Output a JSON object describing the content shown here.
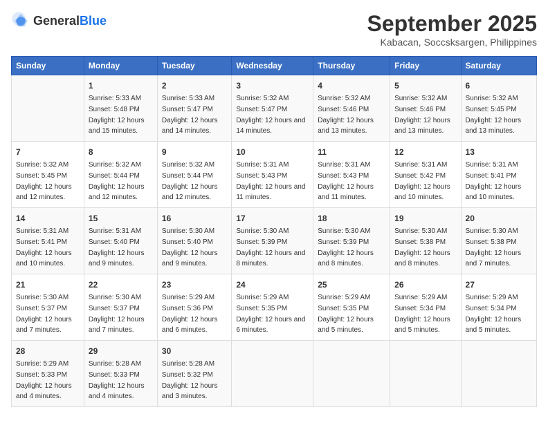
{
  "header": {
    "logo_general": "General",
    "logo_blue": "Blue",
    "title": "September 2025",
    "subtitle": "Kabacan, Soccsksargen, Philippines"
  },
  "days_of_week": [
    "Sunday",
    "Monday",
    "Tuesday",
    "Wednesday",
    "Thursday",
    "Friday",
    "Saturday"
  ],
  "weeks": [
    [
      {
        "day": "",
        "sunrise": "",
        "sunset": "",
        "daylight": ""
      },
      {
        "day": "1",
        "sunrise": "5:33 AM",
        "sunset": "5:48 PM",
        "daylight": "12 hours and 15 minutes."
      },
      {
        "day": "2",
        "sunrise": "5:33 AM",
        "sunset": "5:47 PM",
        "daylight": "12 hours and 14 minutes."
      },
      {
        "day": "3",
        "sunrise": "5:32 AM",
        "sunset": "5:47 PM",
        "daylight": "12 hours and 14 minutes."
      },
      {
        "day": "4",
        "sunrise": "5:32 AM",
        "sunset": "5:46 PM",
        "daylight": "12 hours and 13 minutes."
      },
      {
        "day": "5",
        "sunrise": "5:32 AM",
        "sunset": "5:46 PM",
        "daylight": "12 hours and 13 minutes."
      },
      {
        "day": "6",
        "sunrise": "5:32 AM",
        "sunset": "5:45 PM",
        "daylight": "12 hours and 13 minutes."
      }
    ],
    [
      {
        "day": "7",
        "sunrise": "5:32 AM",
        "sunset": "5:45 PM",
        "daylight": "12 hours and 12 minutes."
      },
      {
        "day": "8",
        "sunrise": "5:32 AM",
        "sunset": "5:44 PM",
        "daylight": "12 hours and 12 minutes."
      },
      {
        "day": "9",
        "sunrise": "5:32 AM",
        "sunset": "5:44 PM",
        "daylight": "12 hours and 12 minutes."
      },
      {
        "day": "10",
        "sunrise": "5:31 AM",
        "sunset": "5:43 PM",
        "daylight": "12 hours and 11 minutes."
      },
      {
        "day": "11",
        "sunrise": "5:31 AM",
        "sunset": "5:43 PM",
        "daylight": "12 hours and 11 minutes."
      },
      {
        "day": "12",
        "sunrise": "5:31 AM",
        "sunset": "5:42 PM",
        "daylight": "12 hours and 10 minutes."
      },
      {
        "day": "13",
        "sunrise": "5:31 AM",
        "sunset": "5:41 PM",
        "daylight": "12 hours and 10 minutes."
      }
    ],
    [
      {
        "day": "14",
        "sunrise": "5:31 AM",
        "sunset": "5:41 PM",
        "daylight": "12 hours and 10 minutes."
      },
      {
        "day": "15",
        "sunrise": "5:31 AM",
        "sunset": "5:40 PM",
        "daylight": "12 hours and 9 minutes."
      },
      {
        "day": "16",
        "sunrise": "5:30 AM",
        "sunset": "5:40 PM",
        "daylight": "12 hours and 9 minutes."
      },
      {
        "day": "17",
        "sunrise": "5:30 AM",
        "sunset": "5:39 PM",
        "daylight": "12 hours and 8 minutes."
      },
      {
        "day": "18",
        "sunrise": "5:30 AM",
        "sunset": "5:39 PM",
        "daylight": "12 hours and 8 minutes."
      },
      {
        "day": "19",
        "sunrise": "5:30 AM",
        "sunset": "5:38 PM",
        "daylight": "12 hours and 8 minutes."
      },
      {
        "day": "20",
        "sunrise": "5:30 AM",
        "sunset": "5:38 PM",
        "daylight": "12 hours and 7 minutes."
      }
    ],
    [
      {
        "day": "21",
        "sunrise": "5:30 AM",
        "sunset": "5:37 PM",
        "daylight": "12 hours and 7 minutes."
      },
      {
        "day": "22",
        "sunrise": "5:30 AM",
        "sunset": "5:37 PM",
        "daylight": "12 hours and 7 minutes."
      },
      {
        "day": "23",
        "sunrise": "5:29 AM",
        "sunset": "5:36 PM",
        "daylight": "12 hours and 6 minutes."
      },
      {
        "day": "24",
        "sunrise": "5:29 AM",
        "sunset": "5:35 PM",
        "daylight": "12 hours and 6 minutes."
      },
      {
        "day": "25",
        "sunrise": "5:29 AM",
        "sunset": "5:35 PM",
        "daylight": "12 hours and 5 minutes."
      },
      {
        "day": "26",
        "sunrise": "5:29 AM",
        "sunset": "5:34 PM",
        "daylight": "12 hours and 5 minutes."
      },
      {
        "day": "27",
        "sunrise": "5:29 AM",
        "sunset": "5:34 PM",
        "daylight": "12 hours and 5 minutes."
      }
    ],
    [
      {
        "day": "28",
        "sunrise": "5:29 AM",
        "sunset": "5:33 PM",
        "daylight": "12 hours and 4 minutes."
      },
      {
        "day": "29",
        "sunrise": "5:28 AM",
        "sunset": "5:33 PM",
        "daylight": "12 hours and 4 minutes."
      },
      {
        "day": "30",
        "sunrise": "5:28 AM",
        "sunset": "5:32 PM",
        "daylight": "12 hours and 3 minutes."
      },
      {
        "day": "",
        "sunrise": "",
        "sunset": "",
        "daylight": ""
      },
      {
        "day": "",
        "sunrise": "",
        "sunset": "",
        "daylight": ""
      },
      {
        "day": "",
        "sunrise": "",
        "sunset": "",
        "daylight": ""
      },
      {
        "day": "",
        "sunrise": "",
        "sunset": "",
        "daylight": ""
      }
    ]
  ]
}
